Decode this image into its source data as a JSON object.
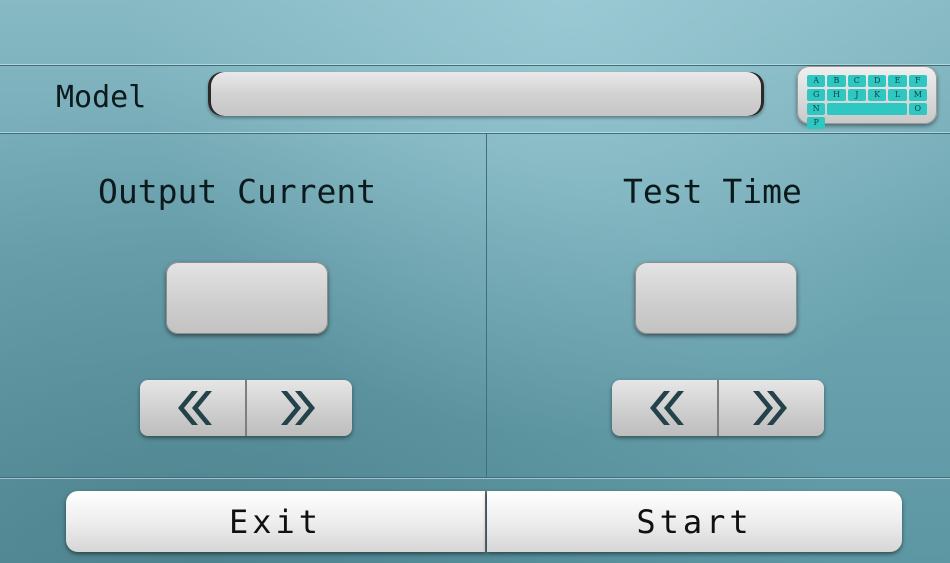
{
  "model": {
    "label": "Model",
    "value": ""
  },
  "keyboard": {
    "icon": "keyboard-icon",
    "keys": [
      "A",
      "B",
      "C",
      "D",
      "E",
      "F",
      "G",
      "H",
      "J",
      "K",
      "L",
      "M",
      "N",
      "",
      "",
      "",
      "O",
      "P"
    ]
  },
  "output_current": {
    "title": "Output Current",
    "value": ""
  },
  "test_time": {
    "title": "Test Time",
    "value": ""
  },
  "controls": {
    "decrease_icon": "double-chevron-left-icon",
    "increase_icon": "double-chevron-right-icon"
  },
  "buttons": {
    "exit": "Exit",
    "start": "Start"
  },
  "colors": {
    "background": "#6ea6b2",
    "accent": "#2fc7c2",
    "rule": "#3f6f79"
  }
}
